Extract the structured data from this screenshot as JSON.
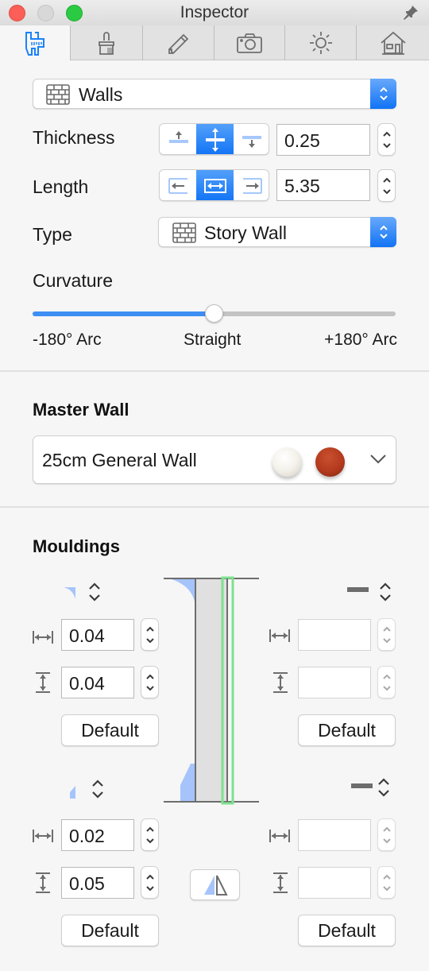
{
  "window": {
    "title": "Inspector",
    "buttons": [
      "close",
      "minimize",
      "zoom"
    ],
    "pin_icon": "pin-icon"
  },
  "tabs": [
    {
      "name": "caliper",
      "icon": "caliper-icon",
      "active": true
    },
    {
      "name": "brush",
      "icon": "brush-icon",
      "active": false
    },
    {
      "name": "pencil",
      "icon": "pencil-icon",
      "active": false
    },
    {
      "name": "camera",
      "icon": "camera-icon",
      "active": false
    },
    {
      "name": "sun",
      "icon": "sun-icon",
      "active": false
    },
    {
      "name": "house",
      "icon": "house-icon",
      "active": false
    }
  ],
  "object_selector": {
    "value": "Walls",
    "icon": "brick-wall-icon"
  },
  "thickness": {
    "label": "Thickness",
    "value": "0.25",
    "alignment_options": [
      "top",
      "center",
      "bottom"
    ],
    "selected": "center"
  },
  "length": {
    "label": "Length",
    "value": "5.35",
    "alignment_options": [
      "left",
      "center",
      "right"
    ],
    "selected": "center"
  },
  "type": {
    "label": "Type",
    "value": "Story Wall",
    "icon": "brick-wall-icon"
  },
  "curvature": {
    "label": "Curvature",
    "value_fraction": 0.5,
    "min_label": "-180° Arc",
    "mid_label": "Straight",
    "max_label": "+180° Arc"
  },
  "master_wall": {
    "title": "Master Wall",
    "value": "25cm General Wall",
    "materials": [
      {
        "name": "white-material",
        "color": "#f3f1ea"
      },
      {
        "name": "red-material",
        "color": "#b43a1e"
      }
    ]
  },
  "mouldings": {
    "title": "Mouldings",
    "top_left": {
      "width": "0.04",
      "height": "0.04",
      "default_label": "Default"
    },
    "top_right": {
      "width": "",
      "height": "",
      "default_label": "Default"
    },
    "bottom_left": {
      "width": "0.02",
      "height": "0.05",
      "default_label": "Default"
    },
    "bottom_right": {
      "width": "",
      "height": "",
      "default_label": "Default"
    },
    "mirror_button": "mirror-icon"
  },
  "colors": {
    "accent": "#1173f5",
    "accent_light": "#a6c8fb",
    "wall_fill": "#e0e0e0",
    "wall_highlight": "#7de28f"
  }
}
